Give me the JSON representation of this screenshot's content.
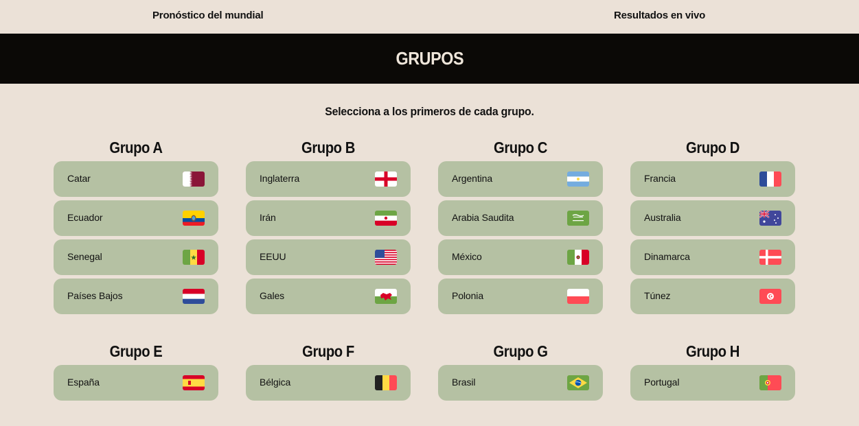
{
  "nav": {
    "left": "Pronóstico del mundial",
    "right": "Resultados en vivo"
  },
  "banner": {
    "title": "GRUPOS"
  },
  "subtitle": "Selecciona a los primeros de cada grupo.",
  "groups": [
    {
      "title": "Grupo A",
      "teams": [
        {
          "name": "Catar",
          "flag": "qatar-flag-icon"
        },
        {
          "name": "Ecuador",
          "flag": "ecuador-flag-icon"
        },
        {
          "name": "Senegal",
          "flag": "senegal-flag-icon"
        },
        {
          "name": "Países Bajos",
          "flag": "netherlands-flag-icon"
        }
      ]
    },
    {
      "title": "Grupo B",
      "teams": [
        {
          "name": "Inglaterra",
          "flag": "england-flag-icon"
        },
        {
          "name": "Irán",
          "flag": "iran-flag-icon"
        },
        {
          "name": "EEUU",
          "flag": "usa-flag-icon"
        },
        {
          "name": "Gales",
          "flag": "wales-flag-icon"
        }
      ]
    },
    {
      "title": "Grupo C",
      "teams": [
        {
          "name": "Argentina",
          "flag": "argentina-flag-icon"
        },
        {
          "name": "Arabia Saudita",
          "flag": "saudi-arabia-flag-icon"
        },
        {
          "name": "México",
          "flag": "mexico-flag-icon"
        },
        {
          "name": "Polonia",
          "flag": "poland-flag-icon"
        }
      ]
    },
    {
      "title": "Grupo D",
      "teams": [
        {
          "name": "Francia",
          "flag": "france-flag-icon"
        },
        {
          "name": "Australia",
          "flag": "australia-flag-icon"
        },
        {
          "name": "Dinamarca",
          "flag": "denmark-flag-icon"
        },
        {
          "name": "Túnez",
          "flag": "tunisia-flag-icon"
        }
      ]
    },
    {
      "title": "Grupo E",
      "teams": [
        {
          "name": "España",
          "flag": "spain-flag-icon"
        }
      ]
    },
    {
      "title": "Grupo F",
      "teams": [
        {
          "name": "Bélgica",
          "flag": "belgium-flag-icon"
        }
      ]
    },
    {
      "title": "Grupo G",
      "teams": [
        {
          "name": "Brasil",
          "flag": "brazil-flag-icon"
        }
      ]
    },
    {
      "title": "Grupo H",
      "teams": [
        {
          "name": "Portugal",
          "flag": "portugal-flag-icon"
        }
      ]
    }
  ],
  "colors": {
    "background": "#ebe1d7",
    "banner": "#0b0906",
    "card": "#b5c1a3"
  }
}
